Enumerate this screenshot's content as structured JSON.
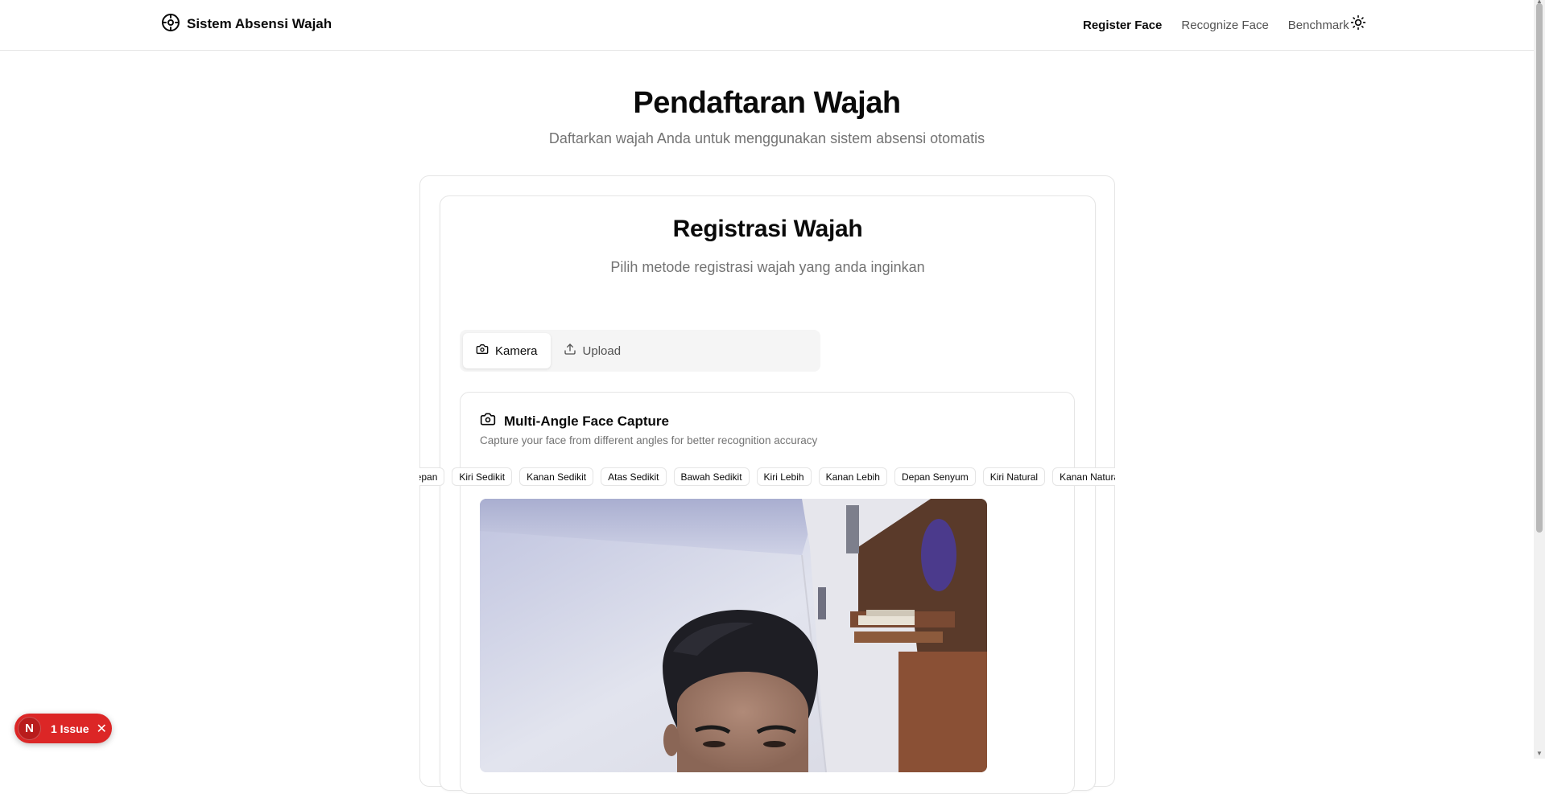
{
  "header": {
    "brand_title": "Sistem Absensi Wajah",
    "brand_icon": "face-target-icon",
    "nav": [
      {
        "label": "Register Face",
        "active": true
      },
      {
        "label": "Recognize Face",
        "active": false
      },
      {
        "label": "Benchmark",
        "active": false
      }
    ],
    "theme_icon": "sun-icon"
  },
  "hero": {
    "title": "Pendaftaran Wajah",
    "subtitle": "Daftarkan wajah Anda untuk menggunakan sistem absensi otomatis"
  },
  "registration": {
    "title": "Registrasi Wajah",
    "subtitle": "Pilih metode registrasi wajah yang anda inginkan",
    "tabs": [
      {
        "label": "Kamera",
        "icon": "camera-icon",
        "active": true
      },
      {
        "label": "Upload",
        "icon": "upload-icon",
        "active": false
      }
    ]
  },
  "capture": {
    "title": "Multi-Angle Face Capture",
    "description": "Capture your face from different angles for better recognition accuracy",
    "angles": [
      "Depan",
      "Kiri Sedikit",
      "Kanan Sedikit",
      "Atas Sedikit",
      "Bawah Sedikit",
      "Kiri Lebih",
      "Kanan Lebih",
      "Depan Senyum",
      "Kiri Natural",
      "Kanan Natural"
    ]
  },
  "issue_badge": {
    "initial": "N",
    "label": "1 Issue",
    "color": "#dc2626"
  },
  "colors": {
    "accent_text": "#0a0a0a",
    "muted_text": "#737373",
    "border": "#e5e5e5"
  }
}
